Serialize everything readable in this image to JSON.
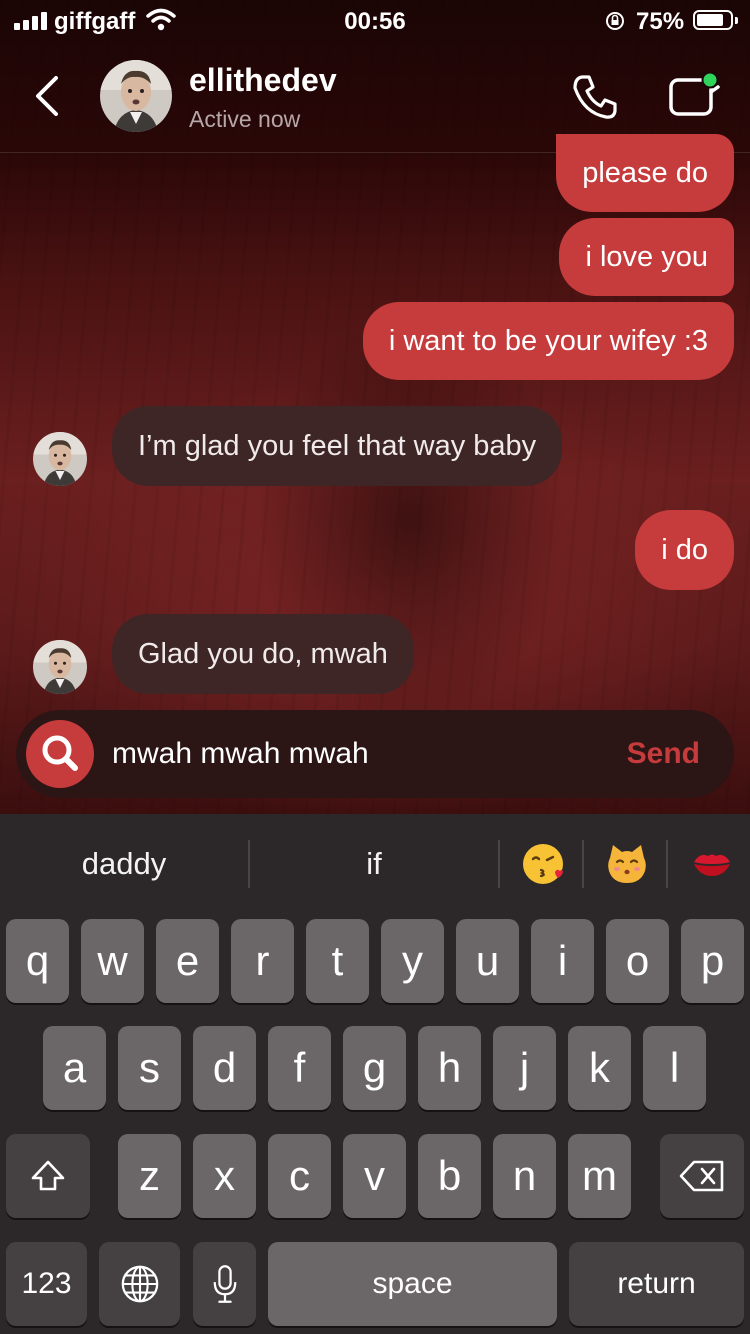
{
  "status_bar": {
    "carrier": "giffgaff",
    "time": "00:56",
    "battery_percent": "75%",
    "battery_level": 0.75
  },
  "header": {
    "contact_name": "ellithedev",
    "presence": "Active now"
  },
  "messages": [
    {
      "direction": "out",
      "text": "please do"
    },
    {
      "direction": "out",
      "text": "i love you"
    },
    {
      "direction": "out",
      "text": "i want to be your wifey :3"
    },
    {
      "direction": "in",
      "text": "I’m glad you feel that way baby"
    },
    {
      "direction": "out",
      "text": "i do"
    },
    {
      "direction": "in",
      "text": "Glad you do, mwah"
    }
  ],
  "composer": {
    "value": "mwah mwah mwah",
    "send_label": "Send"
  },
  "keyboard": {
    "suggestions": [
      "daddy",
      "if"
    ],
    "emoji_suggestions": [
      "😘",
      "😽",
      "💋"
    ],
    "row1": [
      "q",
      "w",
      "e",
      "r",
      "t",
      "y",
      "u",
      "i",
      "o",
      "p"
    ],
    "row2": [
      "a",
      "s",
      "d",
      "f",
      "g",
      "h",
      "j",
      "k",
      "l"
    ],
    "row3": [
      "z",
      "x",
      "c",
      "v",
      "b",
      "n",
      "m"
    ],
    "numbers_label": "123",
    "space_label": "space",
    "return_label": "return"
  },
  "colors": {
    "accent": "#c63b3c",
    "incoming_bubble": "#3f2626",
    "online_dot": "#2fd45a"
  },
  "icons": [
    "back-icon",
    "phone-icon",
    "video-call-icon",
    "search-icon",
    "shift-icon",
    "delete-icon",
    "globe-icon",
    "microphone-icon"
  ]
}
